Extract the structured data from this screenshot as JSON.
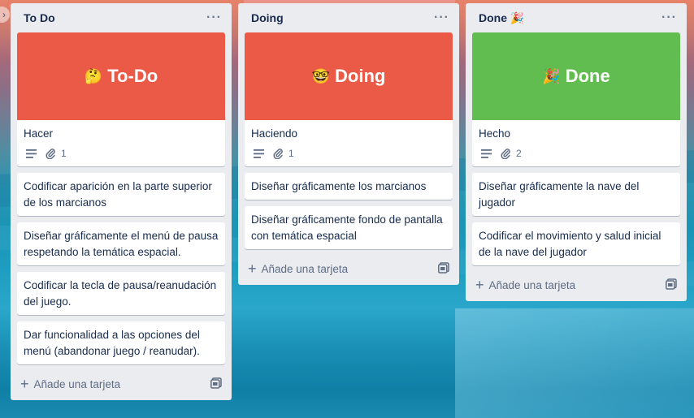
{
  "colors": {
    "red_cover": "#eb5a46",
    "green_cover": "#61bd4f",
    "list_bg": "#ebecf0"
  },
  "lists": [
    {
      "title": "To Do",
      "title_emoji": "",
      "cover": {
        "emoji": "🤔",
        "text": "To-Do",
        "color": "#eb5a46"
      },
      "cover_card": {
        "title": "Hacer",
        "attachments": "1"
      },
      "cards": [
        "Codificar aparición en la parte superior de los marcianos",
        "Diseñar gráficamente el menú de pausa respetando la temática espacial.",
        "Codificar la tecla de pausa/reanudación del juego.",
        "Dar funcionalidad a las opciones del menú (abandonar juego / reanudar)."
      ],
      "add_label": "Añade una tarjeta"
    },
    {
      "title": "Doing",
      "title_emoji": "",
      "cover": {
        "emoji": "🤓",
        "text": "Doing",
        "color": "#eb5a46"
      },
      "cover_card": {
        "title": "Haciendo",
        "attachments": "1"
      },
      "cards": [
        "Diseñar gráficamente los marcianos",
        "Diseñar gráficamente fondo de pantalla con temática espacial"
      ],
      "add_label": "Añade una tarjeta"
    },
    {
      "title": "Done",
      "title_emoji": "🎉",
      "cover": {
        "emoji": "🎉",
        "text": "Done",
        "color": "#61bd4f"
      },
      "cover_card": {
        "title": "Hecho",
        "attachments": "2"
      },
      "cards": [
        "Diseñar gráficamente la nave del jugador",
        "Codificar el movimiento y salud inicial de la nave del jugador"
      ],
      "add_label": "Añade una tarjeta"
    }
  ]
}
